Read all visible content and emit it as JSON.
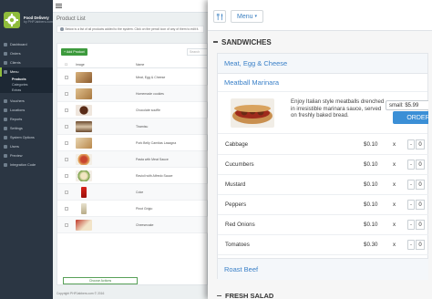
{
  "app": {
    "brand_title": "Food Delivery",
    "brand_subtitle": "by PHPJabbers.com"
  },
  "sidebar": {
    "items": [
      {
        "label": "Dashboard"
      },
      {
        "label": "Orders"
      },
      {
        "label": "Clients"
      },
      {
        "label": "Menu",
        "active": true
      },
      {
        "label": "Vouchers"
      },
      {
        "label": "Locations"
      },
      {
        "label": "Reports"
      },
      {
        "label": "Settings"
      },
      {
        "label": "System Options"
      },
      {
        "label": "Users"
      },
      {
        "label": "Preview"
      },
      {
        "label": "Integration Code"
      }
    ],
    "menu_sub": [
      "Products",
      "Categories",
      "Extras"
    ]
  },
  "center": {
    "page_title": "Product List",
    "notice": "Below is a list of all products added to the system. Click on the pencil icon of any of them to edit it.",
    "add_button": "+ Add Product",
    "search_placeholder": "Search",
    "col_image": "Image",
    "col_name": "Name",
    "products": [
      {
        "name": "Meat, Egg & Cheese"
      },
      {
        "name": "Homemade cookies"
      },
      {
        "name": "Chocolate souffle"
      },
      {
        "name": "Tiramisu"
      },
      {
        "name": "Pork Belly Carnitas Lasagna"
      },
      {
        "name": "Pasta with Meat Sauce"
      },
      {
        "name": "Ravioli with Alfredo Sauce"
      },
      {
        "name": "Coke"
      },
      {
        "name": "Pinot Grigio"
      },
      {
        "name": "Cheesecake"
      }
    ],
    "choose_actions": "Choose Actions",
    "footer": "Copyright PHPJabbers.com © 2016"
  },
  "panel": {
    "menu_button": "Menu",
    "section_title": "SANDWICHES",
    "category": "Meat, Egg & Cheese",
    "subcategory": "Meatball Marinara",
    "item": {
      "description": "Enjoy Italian style meatballs drenched in irresistible marinara sauce, served on freshly baked bread.",
      "size_value": "small: $5.99",
      "order_button": "ORDER"
    },
    "options": [
      {
        "name": "Cabbage",
        "price": "$0.10",
        "times": "x",
        "qty": "0"
      },
      {
        "name": "Cucumbers",
        "price": "$0.10",
        "times": "x",
        "qty": "0"
      },
      {
        "name": "Mustard",
        "price": "$0.10",
        "times": "x",
        "qty": "0"
      },
      {
        "name": "Peppers",
        "price": "$0.10",
        "times": "x",
        "qty": "0"
      },
      {
        "name": "Red Onions",
        "price": "$0.10",
        "times": "x",
        "qty": "0"
      },
      {
        "name": "Tomatoes",
        "price": "$0.30",
        "times": "x",
        "qty": "0"
      }
    ],
    "qty_minus": "-",
    "next_category": "Roast Beef",
    "next_section": "FRESH SALAD"
  }
}
